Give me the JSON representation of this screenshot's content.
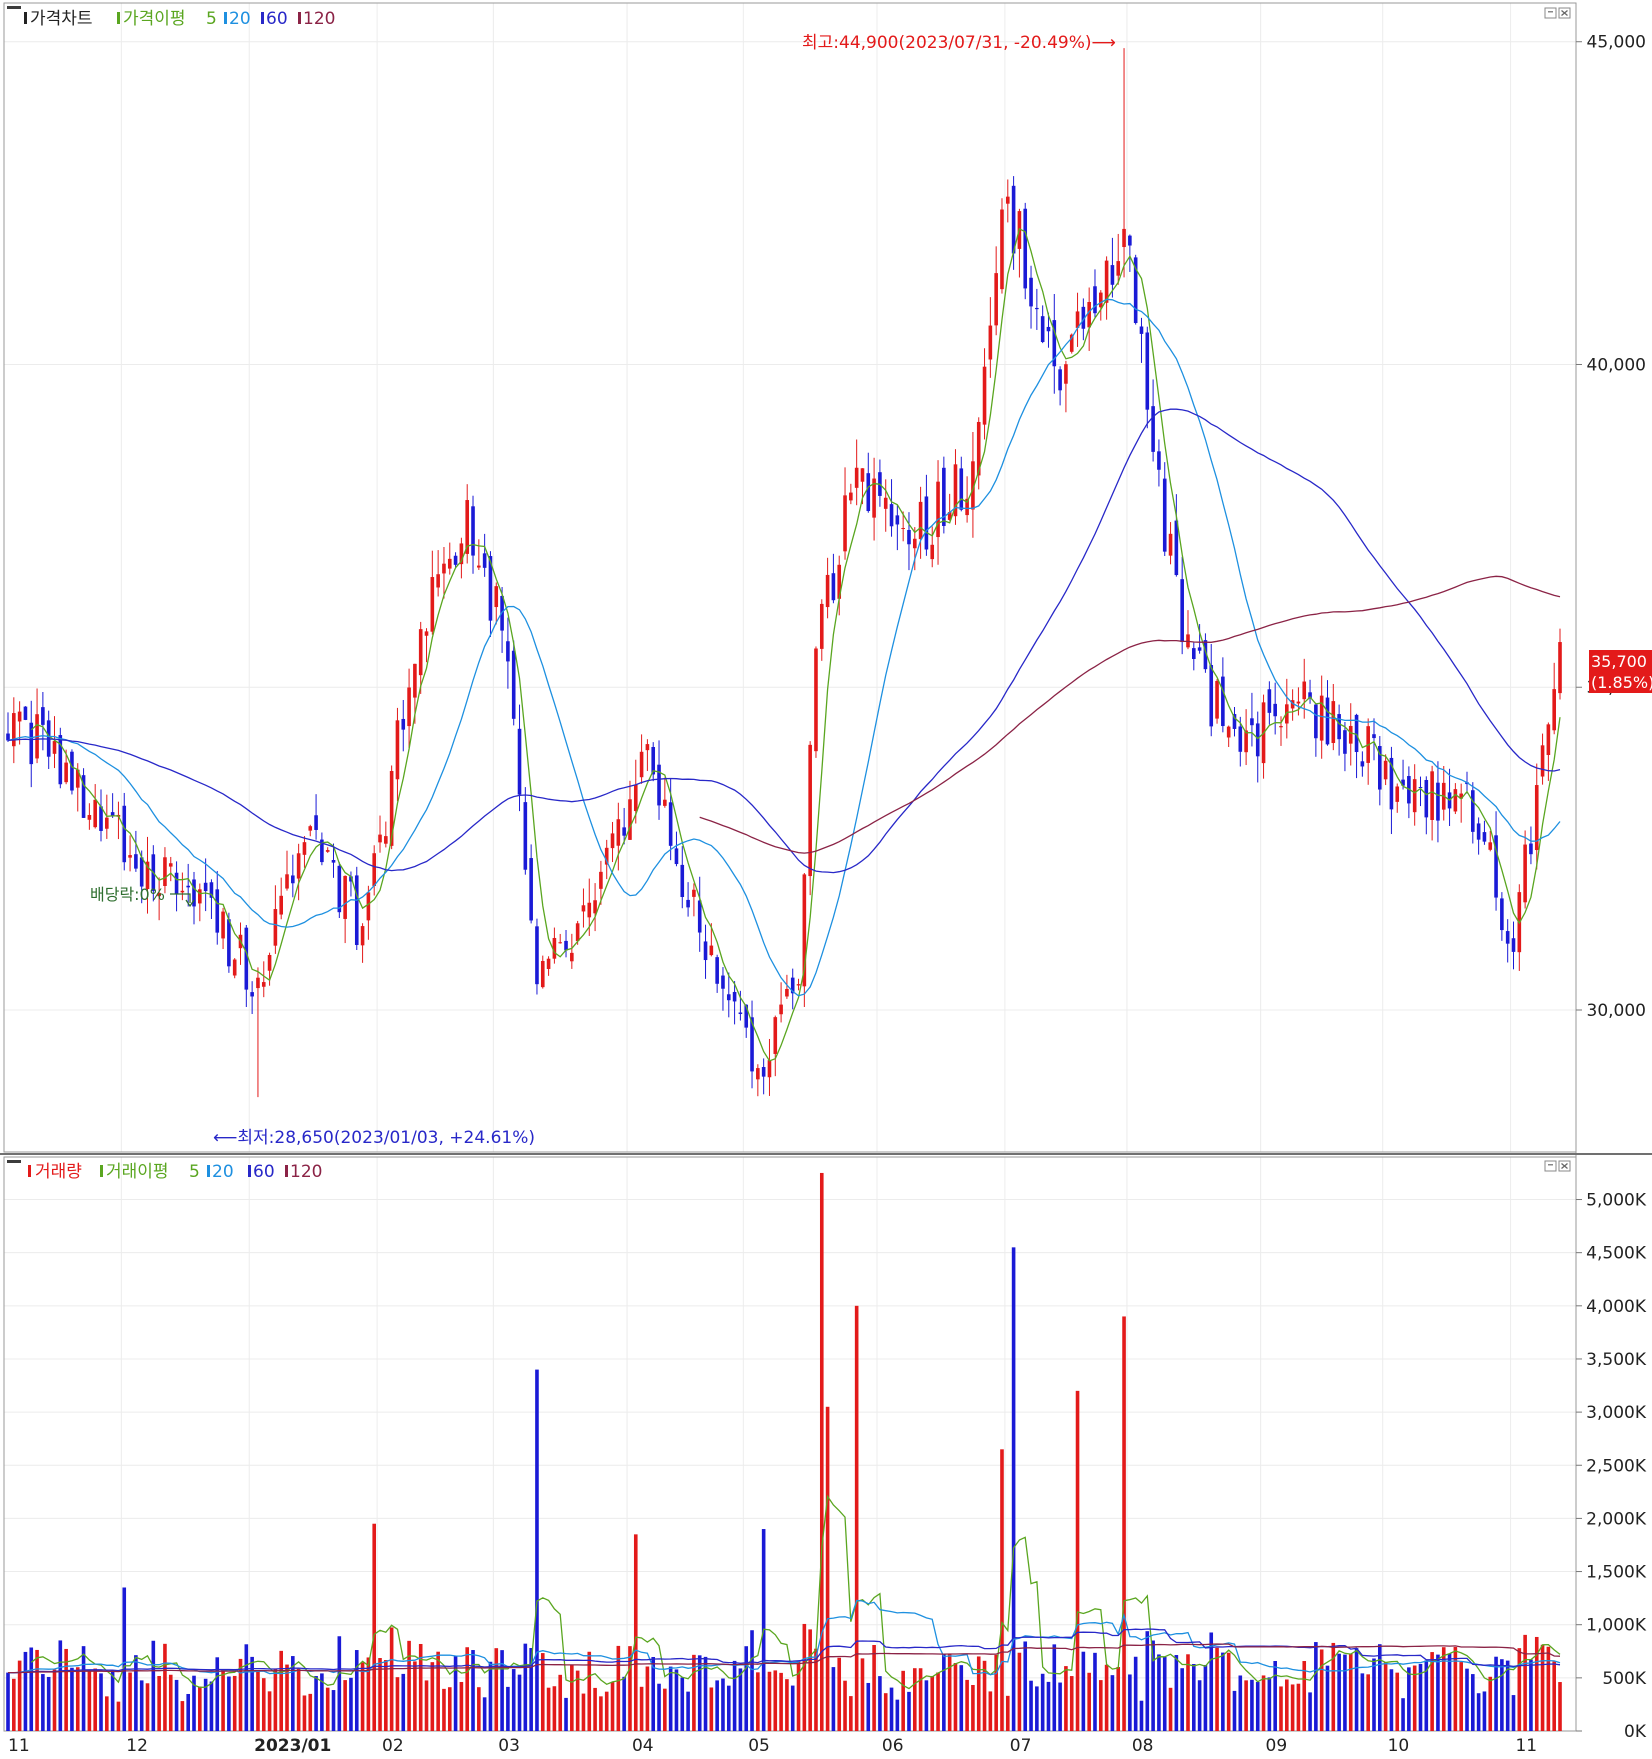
{
  "price_panel": {
    "legend": {
      "price_label": "가격차트",
      "ma_label": "가격이평",
      "periods": [
        "5",
        "20",
        "60",
        "120"
      ]
    },
    "high_annotation": "최고:44,900(2023/07/31, -20.49%)⟶",
    "low_annotation": "⟵최저:28,650(2023/01/03, +24.61%)",
    "marker_label": "배당락:0%",
    "current_price": "35,700",
    "current_change": "(1.85%)"
  },
  "volume_panel": {
    "legend": {
      "volume_label": "거래량",
      "ma_label": "거래이평",
      "periods": [
        "5",
        "20",
        "60",
        "120"
      ]
    }
  },
  "x_labels": [
    "11",
    "12",
    "2023/01",
    "02",
    "03",
    "04",
    "05",
    "06",
    "07",
    "08",
    "09",
    "10",
    "11"
  ],
  "colors": {
    "up": "#e31a1a",
    "down": "#1a1ad6",
    "ma5": "#5aa620",
    "ma20": "#1e90e0",
    "ma60": "#2828c8",
    "ma120": "#8b2346",
    "price_tag_bg": "#e31a1a"
  },
  "chart_data": [
    {
      "type": "candlestick",
      "y_ticks": [
        "45,000",
        "40,000",
        "35,000",
        "30,000"
      ],
      "ylim": [
        27800,
        45600
      ],
      "anchors": [
        {
          "x": "2022/11/04",
          "close": 34600
        },
        {
          "x": "2022/11/18",
          "close": 33400
        },
        {
          "x": "2022/12/02",
          "close": 32400
        },
        {
          "x": "2022/12/16",
          "close": 31900
        },
        {
          "x": "2023/01/03",
          "close": 30500
        },
        {
          "x": "2023/01/13",
          "close": 32600
        },
        {
          "x": "2023/01/27",
          "close": 31300
        },
        {
          "x": "2023/02/10",
          "close": 35900
        },
        {
          "x": "2023/02/22",
          "close": 37900
        },
        {
          "x": "2023/03/03",
          "close": 35400
        },
        {
          "x": "2023/03/10",
          "close": 30400
        },
        {
          "x": "2023/03/24",
          "close": 31700
        },
        {
          "x": "2023/04/05",
          "close": 34000
        },
        {
          "x": "2023/04/19",
          "close": 31200
        },
        {
          "x": "2023/05/03",
          "close": 29100
        },
        {
          "x": "2023/05/12",
          "close": 30400
        },
        {
          "x": "2023/05/17",
          "close": 35600
        },
        {
          "x": "2023/05/26",
          "close": 38400
        },
        {
          "x": "2023/06/09",
          "close": 37300
        },
        {
          "x": "2023/06/23",
          "close": 38500
        },
        {
          "x": "2023/07/03",
          "close": 42600
        },
        {
          "x": "2023/07/14",
          "close": 39600
        },
        {
          "x": "2023/07/31",
          "close": 42100
        },
        {
          "x": "2023/08/04",
          "close": 39300
        },
        {
          "x": "2023/08/14",
          "close": 35700
        },
        {
          "x": "2023/08/28",
          "close": 34000
        },
        {
          "x": "2023/09/08",
          "close": 34800
        },
        {
          "x": "2023/09/22",
          "close": 34400
        },
        {
          "x": "2023/10/06",
          "close": 33200
        },
        {
          "x": "2023/10/20",
          "close": 33500
        },
        {
          "x": "2023/11/01",
          "close": 30900
        },
        {
          "x": "2023/11/08",
          "close": 34100
        },
        {
          "x": "2023/11/13",
          "close": 35700
        }
      ]
    },
    {
      "type": "bar",
      "y_ticks": [
        "5,000K",
        "4,500K",
        "4,000K",
        "3,500K",
        "3,000K",
        "2,500K",
        "2,000K",
        "1,500K",
        "1,000K",
        "500K",
        "0K"
      ],
      "ylim": [
        0,
        5400
      ],
      "unit": "K",
      "spikes": [
        {
          "x": "2022/12/01",
          "value": 1350
        },
        {
          "x": "2023/01/31",
          "value": 1950
        },
        {
          "x": "2023/03/10",
          "value": 3400
        },
        {
          "x": "2023/04/04",
          "value": 1850
        },
        {
          "x": "2023/05/04",
          "value": 1900
        },
        {
          "x": "2023/05/18",
          "value": 5250
        },
        {
          "x": "2023/05/19",
          "value": 3050
        },
        {
          "x": "2023/05/26",
          "value": 4000
        },
        {
          "x": "2023/06/30",
          "value": 2650
        },
        {
          "x": "2023/07/04",
          "value": 4550
        },
        {
          "x": "2023/07/19",
          "value": 3200
        },
        {
          "x": "2023/07/31",
          "value": 3900
        }
      ]
    }
  ]
}
